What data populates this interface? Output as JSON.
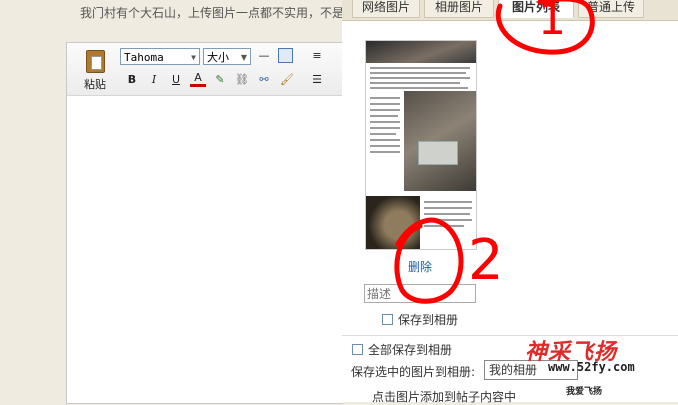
{
  "page": {
    "top_text": "我门村有个大石山，上传图片一点都不实用，不是"
  },
  "editor": {
    "paste_label": "粘贴",
    "font_value": "Tahoma",
    "size_value": "大小",
    "toolbar_buttons": [
      "B",
      "I",
      "U",
      "A"
    ]
  },
  "dialog": {
    "tabs": [
      {
        "label": "网络图片",
        "active": false
      },
      {
        "label": "相册图片",
        "active": false
      },
      {
        "label": "图片列表",
        "active": true
      },
      {
        "label": "普通上传",
        "active": false
      }
    ],
    "delete_label": "删除",
    "desc_placeholder": "描述",
    "save_to_album_label": "保存到相册",
    "save_all_label": "全部保存到相册",
    "save_selected_label": "保存选中的图片到相册:",
    "album_value": "我的相册",
    "hint": "点击图片添加到帖子内容中"
  },
  "annotations": {
    "mark_1": "1",
    "mark_2": "2",
    "color": "#ff0000"
  },
  "watermark": {
    "logo": "神采飞扬",
    "url": "www.52fy.com",
    "sub": "我爱飞扬"
  }
}
